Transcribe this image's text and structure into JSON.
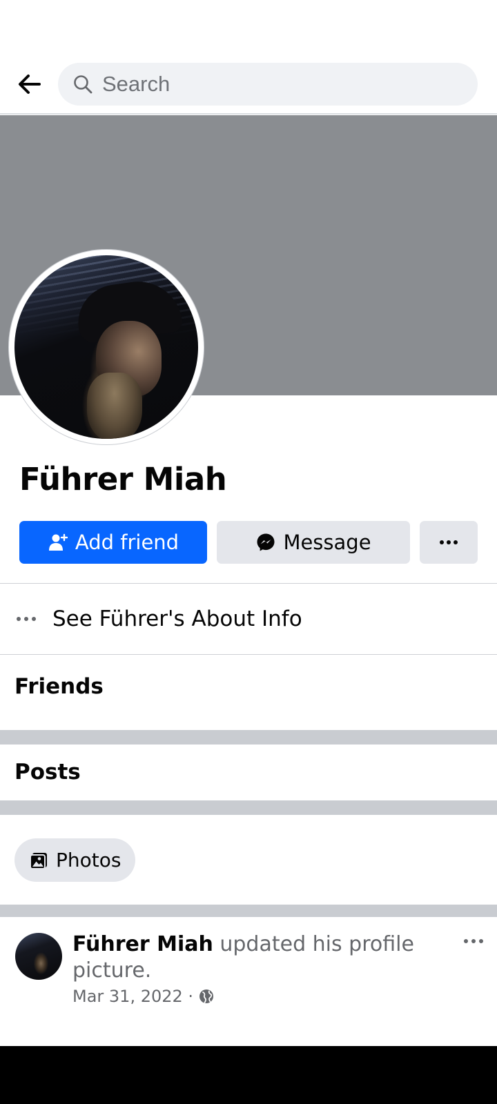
{
  "search": {
    "placeholder": "Search"
  },
  "profile": {
    "name": "Führer Miah"
  },
  "actions": {
    "add_friend": "Add friend",
    "message": "Message"
  },
  "about": {
    "label": "See Führer's About Info"
  },
  "sections": {
    "friends": "Friends",
    "posts": "Posts"
  },
  "chips": {
    "photos": "Photos"
  },
  "post": {
    "author": "Führer Miah",
    "action": " updated his profile picture.",
    "date": "Mar 31, 2022 · ",
    "privacy_icon": "globe-icon"
  },
  "colors": {
    "primary_blue": "#0866ff",
    "button_gray": "#e4e6eb",
    "cover_gray": "#8a8d91",
    "band_gray": "#c9ccd1",
    "secondary_text": "#65676b"
  },
  "icons": {
    "back": "back-arrow-icon",
    "search": "search-icon",
    "add_friend": "add-person-icon",
    "message": "messenger-icon",
    "more": "more-dots-icon",
    "photos": "photos-icon"
  }
}
